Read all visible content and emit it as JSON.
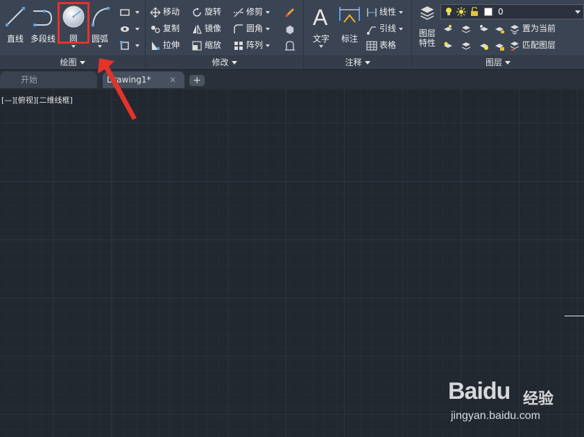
{
  "ribbon": {
    "draw_panel": {
      "title": "绘图",
      "tools": {
        "line": "直线",
        "polyline": "多段线",
        "circle": "圆",
        "arc": "圆弧"
      }
    },
    "modify_panel": {
      "title": "修改",
      "tools": {
        "move": "移动",
        "rotate": "旋转",
        "trim": "修剪",
        "copy": "复制",
        "mirror": "镜像",
        "fillet": "圆角",
        "stretch": "拉伸",
        "scale": "缩放",
        "array": "阵列"
      }
    },
    "annotation_panel": {
      "title": "注释",
      "tools": {
        "text": "文字",
        "dimension": "标注",
        "linear": "线性",
        "leader": "引线",
        "table": "表格"
      }
    },
    "layers_panel": {
      "title": "图层",
      "tools": {
        "layer_properties_line1": "图层",
        "layer_properties_line2": "特性",
        "set_current": "置为当前",
        "match_layer": "匹配图层"
      },
      "current_layer": "0"
    }
  },
  "tabs": {
    "start": "开始",
    "drawing": "Drawing1*",
    "close": "×",
    "add": "+"
  },
  "canvas": {
    "viewport_label": "[—][俯视][二维线框]"
  },
  "watermark": {
    "logo": "Baidu",
    "brand": "经验",
    "url": "jingyan.baidu.com"
  },
  "colors": {
    "ribbon_bg": "#3b4453",
    "canvas_bg": "#212830",
    "highlight": "#e5332a"
  }
}
